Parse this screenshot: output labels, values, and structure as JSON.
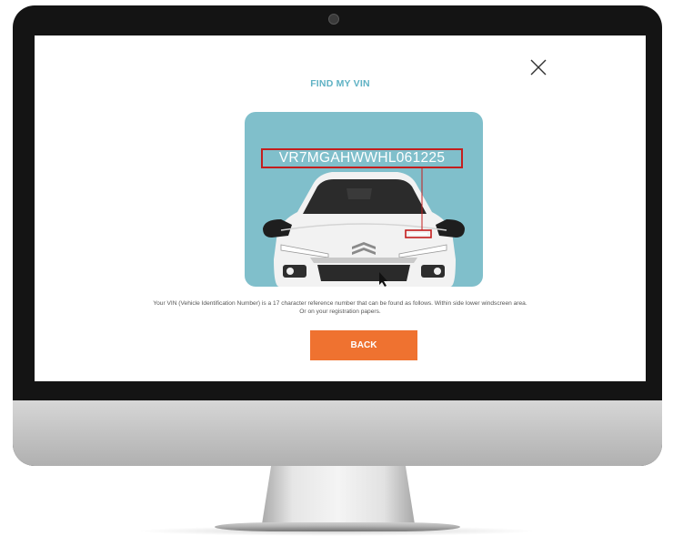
{
  "modal": {
    "title": "FIND MY VIN",
    "vin_example": "VR7MGAHWWHL061225",
    "description": "Your VIN (Vehicle Identification Number) is a 17 character reference number that can be found as follows. Within side lower windscreen area. Or on your registration papers.",
    "back_label": "BACK",
    "close_icon": "close-icon"
  },
  "colors": {
    "title": "#5fb2c4",
    "card_background": "#80bfcb",
    "highlight": "#c41e1e",
    "button": "#ef7230"
  }
}
